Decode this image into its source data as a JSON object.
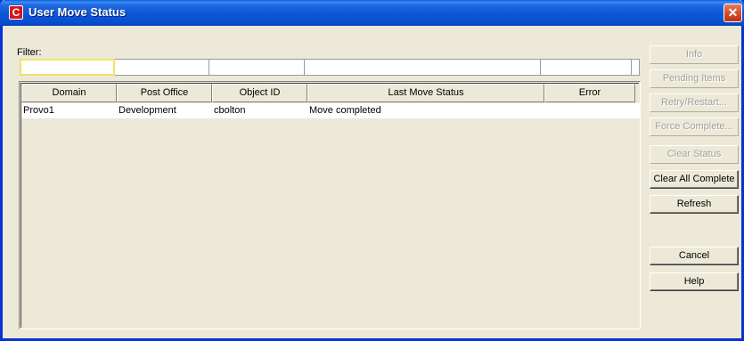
{
  "window": {
    "title": "User Move Status",
    "app_icon_letter": "C",
    "close_glyph": "✕",
    "accent_color": "#0a5fd8"
  },
  "filter": {
    "label": "Filter:",
    "values": [
      "",
      "",
      "",
      "",
      "",
      ""
    ]
  },
  "table": {
    "columns": [
      "Domain",
      "Post Office",
      "Object ID",
      "Last Move Status",
      "Error"
    ],
    "rows": [
      [
        "Provo1",
        "Development",
        "cbolton",
        "Move completed",
        ""
      ]
    ]
  },
  "buttons": {
    "info": "Info",
    "pending_items": "Pending Items",
    "retry_restart": "Retry/Restart...",
    "force_complete": "Force Complete...",
    "clear_status": "Clear Status",
    "clear_all_complete": "Clear All Complete",
    "refresh": "Refresh",
    "cancel": "Cancel",
    "help": "Help"
  }
}
